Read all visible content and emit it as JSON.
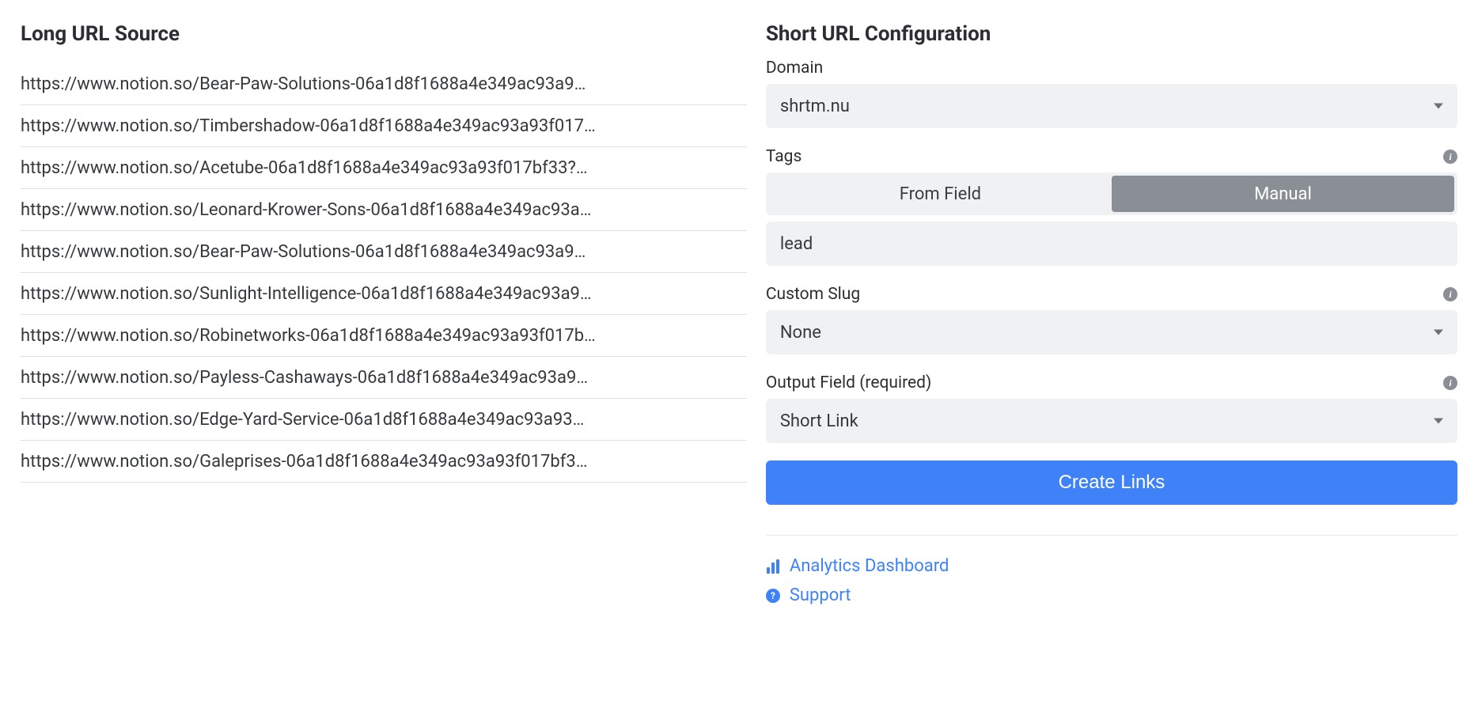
{
  "left": {
    "heading": "Long URL Source",
    "urls": [
      "https://www.notion.so/Bear-Paw-Solutions-06a1d8f1688a4e349ac93a9…",
      "https://www.notion.so/Timbershadow-06a1d8f1688a4e349ac93a93f017…",
      "https://www.notion.so/Acetube-06a1d8f1688a4e349ac93a93f017bf33?…",
      "https://www.notion.so/Leonard-Krower-Sons-06a1d8f1688a4e349ac93a…",
      "https://www.notion.so/Bear-Paw-Solutions-06a1d8f1688a4e349ac93a9…",
      "https://www.notion.so/Sunlight-Intelligence-06a1d8f1688a4e349ac93a9…",
      "https://www.notion.so/Robinetworks-06a1d8f1688a4e349ac93a93f017b…",
      "https://www.notion.so/Payless-Cashaways-06a1d8f1688a4e349ac93a9…",
      "https://www.notion.so/Edge-Yard-Service-06a1d8f1688a4e349ac93a93…",
      "https://www.notion.so/Galeprises-06a1d8f1688a4e349ac93a93f017bf3…"
    ]
  },
  "right": {
    "heading": "Short URL Configuration",
    "domain": {
      "label": "Domain",
      "value": "shrtm.nu"
    },
    "tags": {
      "label": "Tags",
      "options": [
        "From Field",
        "Manual"
      ],
      "selected": 1,
      "value": "lead"
    },
    "slug": {
      "label": "Custom Slug",
      "value": "None"
    },
    "output": {
      "label": "Output Field (required)",
      "value": "Short Link"
    },
    "submit": "Create Links",
    "footer": {
      "analytics": "Analytics Dashboard",
      "support": "Support"
    }
  }
}
